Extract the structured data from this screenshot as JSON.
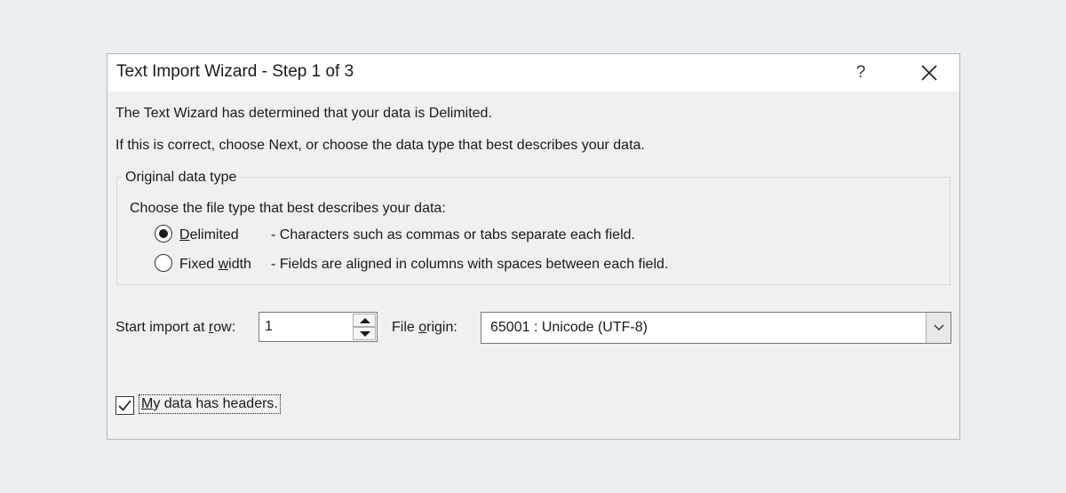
{
  "dialog": {
    "title": "Text Import Wizard - Step 1 of 3",
    "help_label": "?",
    "close_icon": "close-icon"
  },
  "intro": {
    "line1": "The Text Wizard has determined that your data is Delimited.",
    "line2": "If this is correct, choose Next, or choose the data type that best describes your data."
  },
  "original_data_type": {
    "group_label": "Original data type",
    "prompt": "Choose the file type that best describes your data:",
    "options": [
      {
        "label_prefix": "",
        "label_accel": "D",
        "label_suffix": "elimited",
        "description": "- Characters such as commas or tabs separate each field.",
        "selected": true
      },
      {
        "label_prefix": "Fixed ",
        "label_accel": "w",
        "label_suffix": "idth",
        "description": "- Fields are aligned in columns with spaces between each field.",
        "selected": false
      }
    ]
  },
  "start_row": {
    "label_prefix": "Start import at ",
    "label_accel": "r",
    "label_suffix": "ow:",
    "value": "1"
  },
  "file_origin": {
    "label_prefix": "File ",
    "label_accel": "o",
    "label_suffix": "rigin:",
    "value": "65001 : Unicode (UTF-8)"
  },
  "headers_checkbox": {
    "label_accel": "M",
    "label_suffix": "y data has headers.",
    "checked": true
  }
}
